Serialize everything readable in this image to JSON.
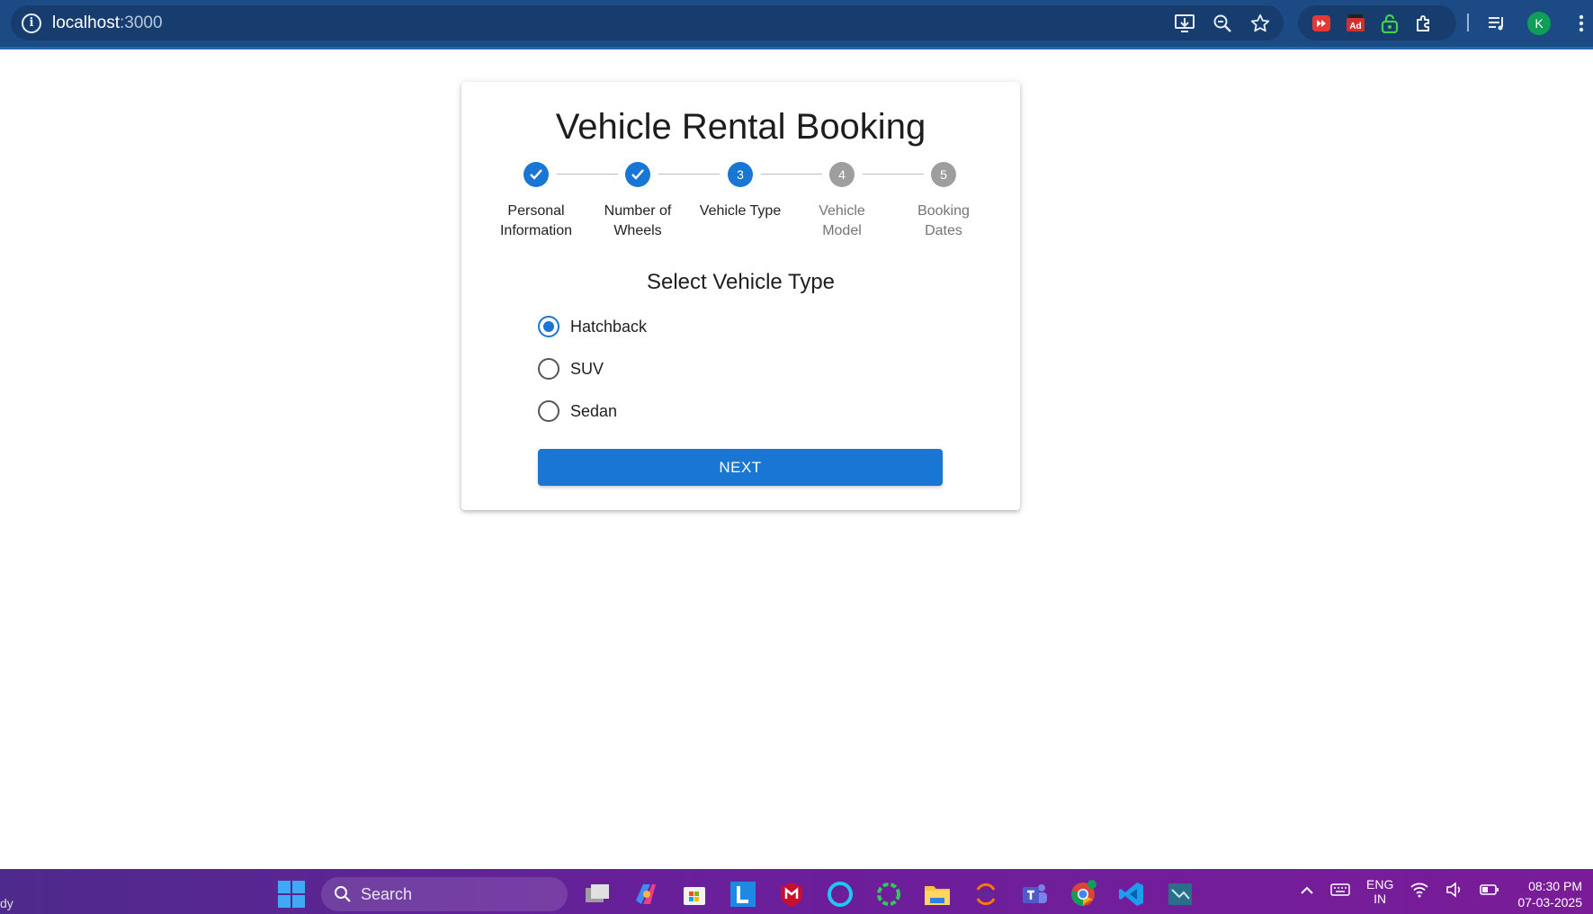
{
  "browser": {
    "url_host": "localhost",
    "url_port": ":3000",
    "profile_initial": "K"
  },
  "page": {
    "title": "Vehicle Rental Booking",
    "section_title": "Select Vehicle Type",
    "steps": [
      {
        "number": "1",
        "label_line1": "Personal",
        "label_line2": "Information",
        "state": "done"
      },
      {
        "number": "2",
        "label_line1": "Number of",
        "label_line2": "Wheels",
        "state": "done"
      },
      {
        "number": "3",
        "label_line1": "Vehicle Type",
        "label_line2": "",
        "state": "active"
      },
      {
        "number": "4",
        "label_line1": "Vehicle",
        "label_line2": "Model",
        "state": "todo"
      },
      {
        "number": "5",
        "label_line1": "Booking",
        "label_line2": "Dates",
        "state": "todo"
      }
    ],
    "options": [
      {
        "label": "Hatchback",
        "checked": true
      },
      {
        "label": "SUV",
        "checked": false
      },
      {
        "label": "Sedan",
        "checked": false
      }
    ],
    "next_label": "NEXT"
  },
  "taskbar": {
    "left_fragment": "dy",
    "search_label": "Search",
    "lang_line1": "ENG",
    "lang_line2": "IN",
    "time": "08:30 PM",
    "date": "07-03-2025"
  },
  "colors": {
    "primary": "#1976d2",
    "inactive_step": "#9e9e9e",
    "chrome_bg": "#1b4a85"
  }
}
